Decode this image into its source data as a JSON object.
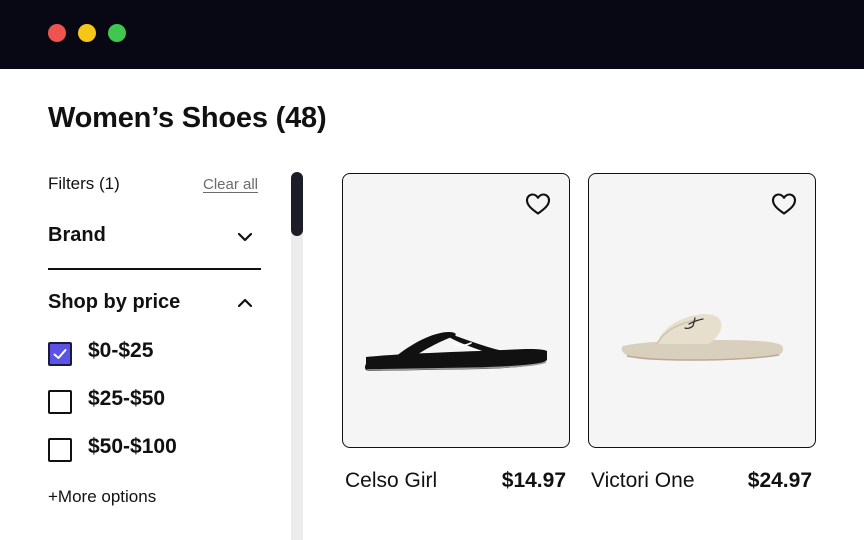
{
  "window": {
    "controls": [
      "close",
      "minimize",
      "maximize"
    ]
  },
  "page": {
    "title": "Women’s Shoes (48)"
  },
  "filters": {
    "heading": "Filters (1)",
    "clear_all": "Clear all",
    "brand": {
      "title": "Brand",
      "expanded": false
    },
    "price": {
      "title": "Shop by price",
      "expanded": true,
      "options": [
        {
          "label": "$0-$25",
          "checked": true
        },
        {
          "label": "$25-$50",
          "checked": false
        },
        {
          "label": "$50-$100",
          "checked": false
        }
      ]
    },
    "more_options": "+More options"
  },
  "products": [
    {
      "name": "Celso Girl",
      "price": "$14.97",
      "favorited": false,
      "image": "black flip-flop sandal"
    },
    {
      "name": "Victori One",
      "price": "$24.97",
      "favorited": false,
      "image": "cream slide sandal"
    }
  ],
  "colors": {
    "accent": "#5b52e6",
    "titlebar": "#070814",
    "card_bg": "#f5f5f5"
  }
}
